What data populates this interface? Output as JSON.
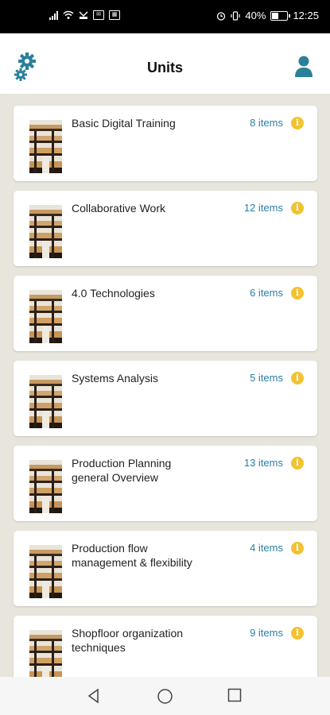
{
  "status_bar": {
    "battery_percent": "40%",
    "time": "12:25",
    "left_icons": [
      "signal-icon",
      "wifi-icon",
      "missed-call-icon",
      "mail-icon",
      "app-icon"
    ],
    "right_icons": [
      "alarm-icon",
      "vibrate-icon",
      "battery-icon"
    ]
  },
  "header": {
    "title": "Units",
    "left_icon": "gear-icon",
    "right_icon": "user-icon"
  },
  "units": [
    {
      "title": "Basic Digital Training",
      "count": "8 items"
    },
    {
      "title": "Collaborative Work",
      "count": "12 items"
    },
    {
      "title": "4.0 Technologies",
      "count": "6 items"
    },
    {
      "title": "Systems Analysis",
      "count": "5 items"
    },
    {
      "title": "Production Planning general Overview",
      "count": "13 items"
    },
    {
      "title": "Production flow management & flexibility",
      "count": "4 items"
    },
    {
      "title": "Shopfloor organization techniques",
      "count": "9 items"
    }
  ],
  "nav": [
    "back-icon",
    "home-icon",
    "recents-icon"
  ],
  "colors": {
    "accent": "#2a7fa3",
    "info": "#f2c230",
    "background": "#e8e5dc"
  }
}
